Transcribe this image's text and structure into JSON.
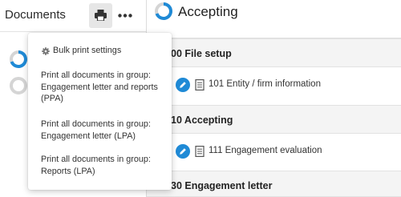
{
  "left_panel": {
    "title": "Documents",
    "print_icon": "printer-icon",
    "more_icon": "more-horizontal-icon"
  },
  "main": {
    "title": "Accepting",
    "title_icon": "progress-ring-icon",
    "sections": [
      {
        "title": "00 File setup",
        "documents": [
          {
            "label": "101 Entity / firm information",
            "action_icon": "pencil-icon",
            "type_icon": "document-icon"
          }
        ]
      },
      {
        "title": "10 Accepting",
        "documents": [
          {
            "label": "111 Engagement evaluation",
            "action_icon": "pencil-icon",
            "type_icon": "document-icon"
          }
        ]
      },
      {
        "title": "30 Engagement letter",
        "documents": []
      }
    ]
  },
  "menu": {
    "items": [
      {
        "label": "Bulk print settings",
        "icon": "gear-icon"
      },
      {
        "label": "Print all documents in group: Engagement letter and reports (PPA)"
      },
      {
        "label": "Print all documents in group: Engagement letter (LPA)"
      },
      {
        "label": "Print all documents in group: Reports (LPA)"
      }
    ]
  },
  "colors": {
    "accent": "#1f8ad6",
    "progress_track": "#d5d5d5",
    "section_bg": "#f4f4f4",
    "button_bg": "#e6e6e6"
  }
}
